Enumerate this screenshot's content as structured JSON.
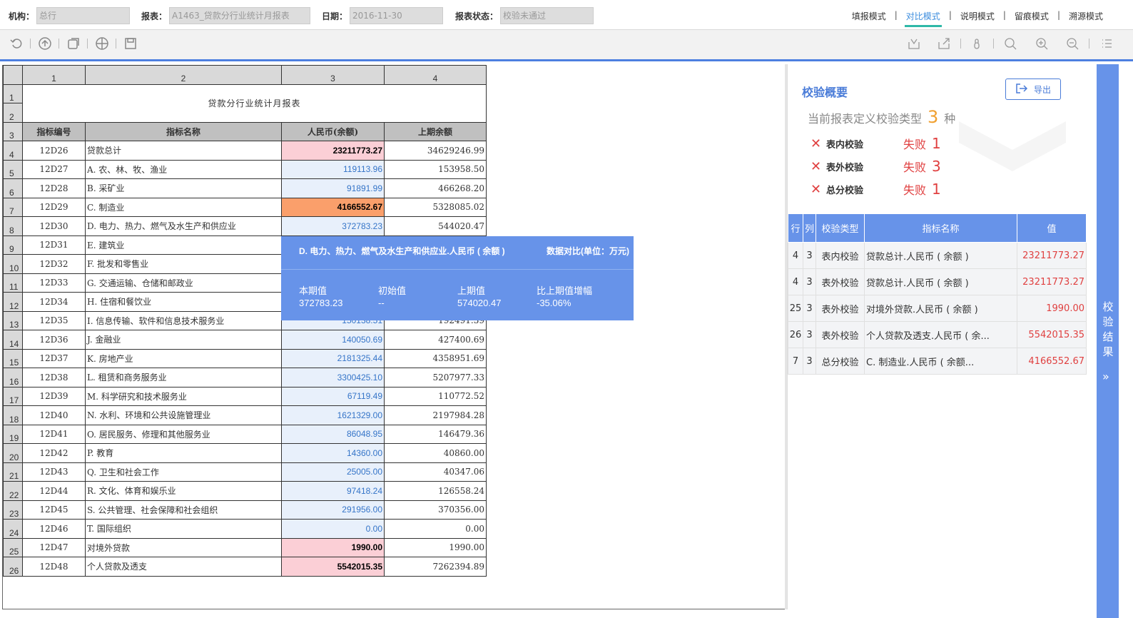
{
  "filters": {
    "org_label": "机构：",
    "org_value": "总行",
    "report_label": "报表：",
    "report_value": "A1463_贷款分行业统计月报表",
    "date_label": "日期：",
    "date_value": "2016-11-30",
    "status_label": "报表状态：",
    "status_value": "校验未通过"
  },
  "modes": [
    "填报模式",
    "对比模式",
    "说明模式",
    "留痕模式",
    "溯源模式"
  ],
  "active_mode": "对比模式",
  "sheet": {
    "col_headers": [
      "1",
      "2",
      "3",
      "4"
    ],
    "title": "贷款分行业统计月报表",
    "field_headers": [
      "指标编号",
      "指标名称",
      "人民币(余额)",
      "上期余额"
    ],
    "rows": [
      {
        "n": "4",
        "code": "12D26",
        "name": "贷款总计",
        "cur": "23211773.27",
        "prev": "34629246.99",
        "hl": "pink"
      },
      {
        "n": "5",
        "code": "12D27",
        "name": "A. 农、林、牧、渔业",
        "cur": "119113.96",
        "prev": "153958.50",
        "hl": ""
      },
      {
        "n": "6",
        "code": "12D28",
        "name": "B. 采矿业",
        "cur": "91891.99",
        "prev": "466268.20",
        "hl": ""
      },
      {
        "n": "7",
        "code": "12D29",
        "name": "C. 制造业",
        "cur": "4166552.67",
        "prev": "5328085.02",
        "hl": "orange"
      },
      {
        "n": "8",
        "code": "12D30",
        "name": "D. 电力、热力、燃气及水生产和供应业",
        "cur": "372783.23",
        "prev": "544020.47",
        "hl": ""
      },
      {
        "n": "9",
        "code": "12D31",
        "name": "E. 建筑业",
        "cur": "",
        "prev": "",
        "hl": ""
      },
      {
        "n": "10",
        "code": "12D32",
        "name": "F. 批发和零售业",
        "cur": "",
        "prev": "",
        "hl": ""
      },
      {
        "n": "11",
        "code": "12D33",
        "name": "G. 交通运输、仓储和邮政业",
        "cur": "",
        "prev": "",
        "hl": ""
      },
      {
        "n": "12",
        "code": "12D34",
        "name": "H. 住宿和餐饮业",
        "cur": "",
        "prev": "",
        "hl": ""
      },
      {
        "n": "13",
        "code": "12D35",
        "name": "I. 信息传输、软件和信息技术服务业",
        "cur": "150138.51",
        "prev": "192491.39",
        "hl": ""
      },
      {
        "n": "14",
        "code": "12D36",
        "name": "J. 金融业",
        "cur": "140050.69",
        "prev": "427400.69",
        "hl": ""
      },
      {
        "n": "15",
        "code": "12D37",
        "name": "K. 房地产业",
        "cur": "2181325.44",
        "prev": "4358951.69",
        "hl": ""
      },
      {
        "n": "16",
        "code": "12D38",
        "name": "L. 租赁和商务服务业",
        "cur": "3300425.10",
        "prev": "5207977.33",
        "hl": ""
      },
      {
        "n": "17",
        "code": "12D39",
        "name": "M. 科学研究和技术服务业",
        "cur": "67119.49",
        "prev": "110772.52",
        "hl": ""
      },
      {
        "n": "18",
        "code": "12D40",
        "name": "N. 水利、环境和公共设施管理业",
        "cur": "1621329.00",
        "prev": "2197984.28",
        "hl": ""
      },
      {
        "n": "19",
        "code": "12D41",
        "name": "O. 居民服务、修理和其他服务业",
        "cur": "86048.95",
        "prev": "146479.36",
        "hl": ""
      },
      {
        "n": "20",
        "code": "12D42",
        "name": "P. 教育",
        "cur": "14360.00",
        "prev": "40860.00",
        "hl": ""
      },
      {
        "n": "21",
        "code": "12D43",
        "name": "Q. 卫生和社会工作",
        "cur": "25005.00",
        "prev": "40347.06",
        "hl": ""
      },
      {
        "n": "22",
        "code": "12D44",
        "name": "R. 文化、体育和娱乐业",
        "cur": "97418.24",
        "prev": "126558.24",
        "hl": ""
      },
      {
        "n": "23",
        "code": "12D45",
        "name": "S. 公共管理、社会保障和社会组织",
        "cur": "291956.00",
        "prev": "370356.00",
        "hl": ""
      },
      {
        "n": "24",
        "code": "12D46",
        "name": "T. 国际组织",
        "cur": "0.00",
        "prev": "0.00",
        "hl": ""
      },
      {
        "n": "25",
        "code": "12D47",
        "name": "对境外贷款",
        "cur": "1990.00",
        "prev": "1990.00",
        "hl": "pink"
      },
      {
        "n": "26",
        "code": "12D48",
        "name": "个人贷款及透支",
        "cur": "5542015.35",
        "prev": "7262394.89",
        "hl": "pink"
      }
    ]
  },
  "tooltip": {
    "title": "D. 电力、热力、燃气及水生产和供应业.人民币 ( 余额 )",
    "unit": "数据对比(单位：万元)",
    "labels": [
      "本期值",
      "初始值",
      "上期值",
      "比上期值增幅"
    ],
    "values": [
      "372783.23",
      "--",
      "574020.47",
      "-35.06%"
    ]
  },
  "panel": {
    "title": "校验概要",
    "export_label": "导出",
    "summary_prefix": "当前报表定义校验类型",
    "summary_count": "3",
    "summary_suffix": "种",
    "checks": [
      {
        "name": "表内校验",
        "result": "失败",
        "count": "1"
      },
      {
        "name": "表外校验",
        "result": "失败",
        "count": "3"
      },
      {
        "name": "总分校验",
        "result": "失败",
        "count": "1"
      }
    ],
    "table_headers": [
      "行",
      "列",
      "校验类型",
      "指标名称",
      "值"
    ],
    "table_rows": [
      [
        "4",
        "3",
        "表内校验",
        "贷款总计.人民币 ( 余额 )",
        "23211773.27"
      ],
      [
        "4",
        "3",
        "表外校验",
        "贷款总计.人民币 ( 余额 )",
        "23211773.27"
      ],
      [
        "25",
        "3",
        "表外校验",
        "对境外贷款.人民币 ( 余额 )",
        "1990.00"
      ],
      [
        "26",
        "3",
        "表外校验",
        "个人贷款及透支.人民币 ( 余...",
        "5542015.35"
      ],
      [
        "7",
        "3",
        "总分校验",
        "C. 制造业.人民币 ( 余额...",
        "4166552.67"
      ]
    ]
  },
  "side_tab": {
    "label": "校验结果",
    "arrow": "»"
  },
  "colors": {
    "accent": "#6793e9",
    "error": "#e04040",
    "highlight_pink": "#fbcfd6",
    "highlight_orange": "#fa9f6b"
  }
}
